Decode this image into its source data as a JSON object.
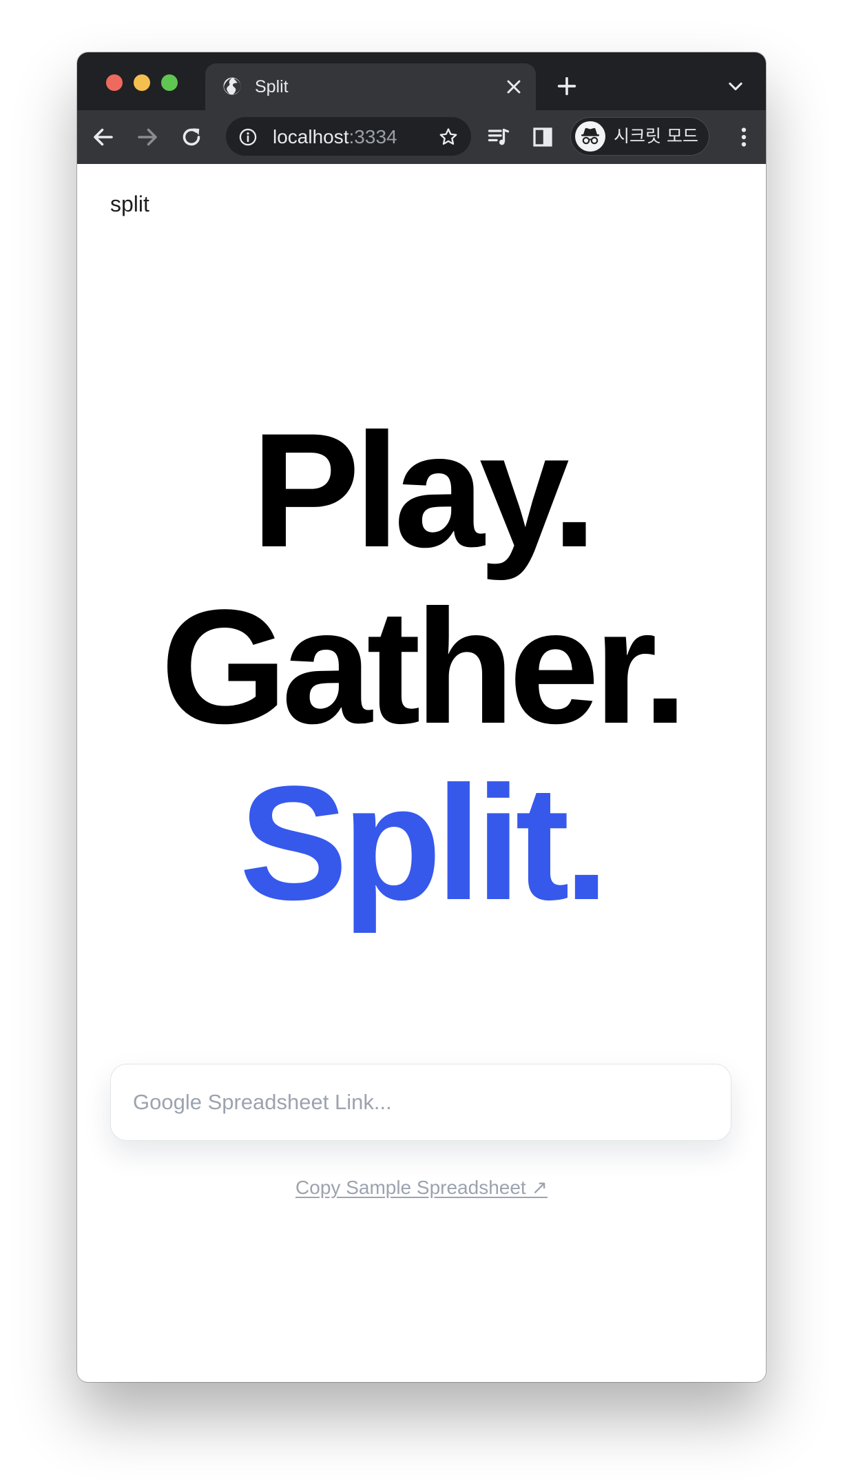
{
  "browser": {
    "tab": {
      "title": "Split",
      "icon": "globe-icon"
    },
    "address_bar": {
      "host": "localhost",
      "port": ":3334"
    },
    "profile": {
      "label": "시크릿 모드",
      "icon": "incognito-icon"
    }
  },
  "page": {
    "brand": "split",
    "hero": {
      "line1": "Play.",
      "line2": "Gather.",
      "line3": "Split."
    },
    "search": {
      "placeholder": "Google Spreadsheet Link..."
    },
    "sample_link": {
      "label": "Copy Sample Spreadsheet ↗"
    }
  },
  "colors": {
    "accent": "#3659ec",
    "chrome_dark": "#202124",
    "chrome_toolbar": "#35363a"
  }
}
